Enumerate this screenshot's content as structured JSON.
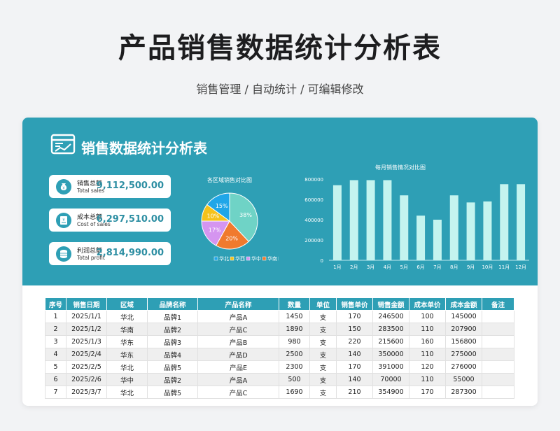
{
  "title": "产品销售数据统计分析表",
  "subtitle": "销售管理 / 自动统计 / 可编辑修改",
  "banner_title": "销售数据统计分析表",
  "kpis": [
    {
      "label": "销售总额",
      "label_en": "Total sales",
      "value": "9,112,500.00",
      "icon": "money-bag-icon"
    },
    {
      "label": "成本总额",
      "label_en": "Cost of sales",
      "value": "6,297,510.00",
      "icon": "invoice-icon"
    },
    {
      "label": "利润总额",
      "label_en": "Total profit",
      "value": "2,814,990.00",
      "icon": "coins-icon"
    }
  ],
  "colors": {
    "accent": "#2e9fb5",
    "header": "#2e9fb5",
    "bar": "#c4f4ef"
  },
  "chart_data": [
    {
      "type": "pie",
      "title": "各区域销售对比图",
      "categories": [
        "华北",
        "华西",
        "华中",
        "华南",
        "华东"
      ],
      "values": [
        15,
        10,
        17,
        20,
        38
      ],
      "data_labels": [
        "15%",
        "10%",
        "17%",
        "20%",
        "38%"
      ],
      "colors": [
        "#1fa6e8",
        "#f5c21b",
        "#d595f0",
        "#f07a2e",
        "#6fd3c6"
      ],
      "legend": "bottom"
    },
    {
      "type": "bar",
      "title": "每月销售情况对比图",
      "categories": [
        "1月",
        "2月",
        "3月",
        "4月",
        "5月",
        "6月",
        "7月",
        "8月",
        "9月",
        "10月",
        "11月",
        "12月"
      ],
      "values": [
        740000,
        790000,
        790000,
        790000,
        640000,
        440000,
        400000,
        640000,
        570000,
        580000,
        750000,
        750000
      ],
      "yticks": [
        "0",
        "200000",
        "400000",
        "600000",
        "800000"
      ],
      "ylim": [
        0,
        800000
      ],
      "grid": false
    }
  ],
  "table": {
    "headers": [
      "序号",
      "销售日期",
      "区域",
      "品牌名称",
      "产品名称",
      "数量",
      "单位",
      "销售单价",
      "销售金额",
      "成本单价",
      "成本金额",
      "备注"
    ],
    "rows": [
      [
        "1",
        "2025/1/1",
        "华北",
        "品牌1",
        "产品A",
        "1450",
        "支",
        "170",
        "246500",
        "100",
        "145000",
        ""
      ],
      [
        "2",
        "2025/1/2",
        "华南",
        "品牌2",
        "产品C",
        "1890",
        "支",
        "150",
        "283500",
        "110",
        "207900",
        ""
      ],
      [
        "3",
        "2025/1/3",
        "华东",
        "品牌3",
        "产品B",
        "980",
        "支",
        "220",
        "215600",
        "160",
        "156800",
        ""
      ],
      [
        "4",
        "2025/2/4",
        "华东",
        "品牌4",
        "产品D",
        "2500",
        "支",
        "140",
        "350000",
        "110",
        "275000",
        ""
      ],
      [
        "5",
        "2025/2/5",
        "华北",
        "品牌5",
        "产品E",
        "2300",
        "支",
        "170",
        "391000",
        "120",
        "276000",
        ""
      ],
      [
        "6",
        "2025/2/6",
        "华中",
        "品牌2",
        "产品A",
        "500",
        "支",
        "140",
        "70000",
        "110",
        "55000",
        ""
      ],
      [
        "7",
        "2025/3/7",
        "华北",
        "品牌5",
        "产品C",
        "1690",
        "支",
        "210",
        "354900",
        "170",
        "287300",
        ""
      ]
    ]
  }
}
